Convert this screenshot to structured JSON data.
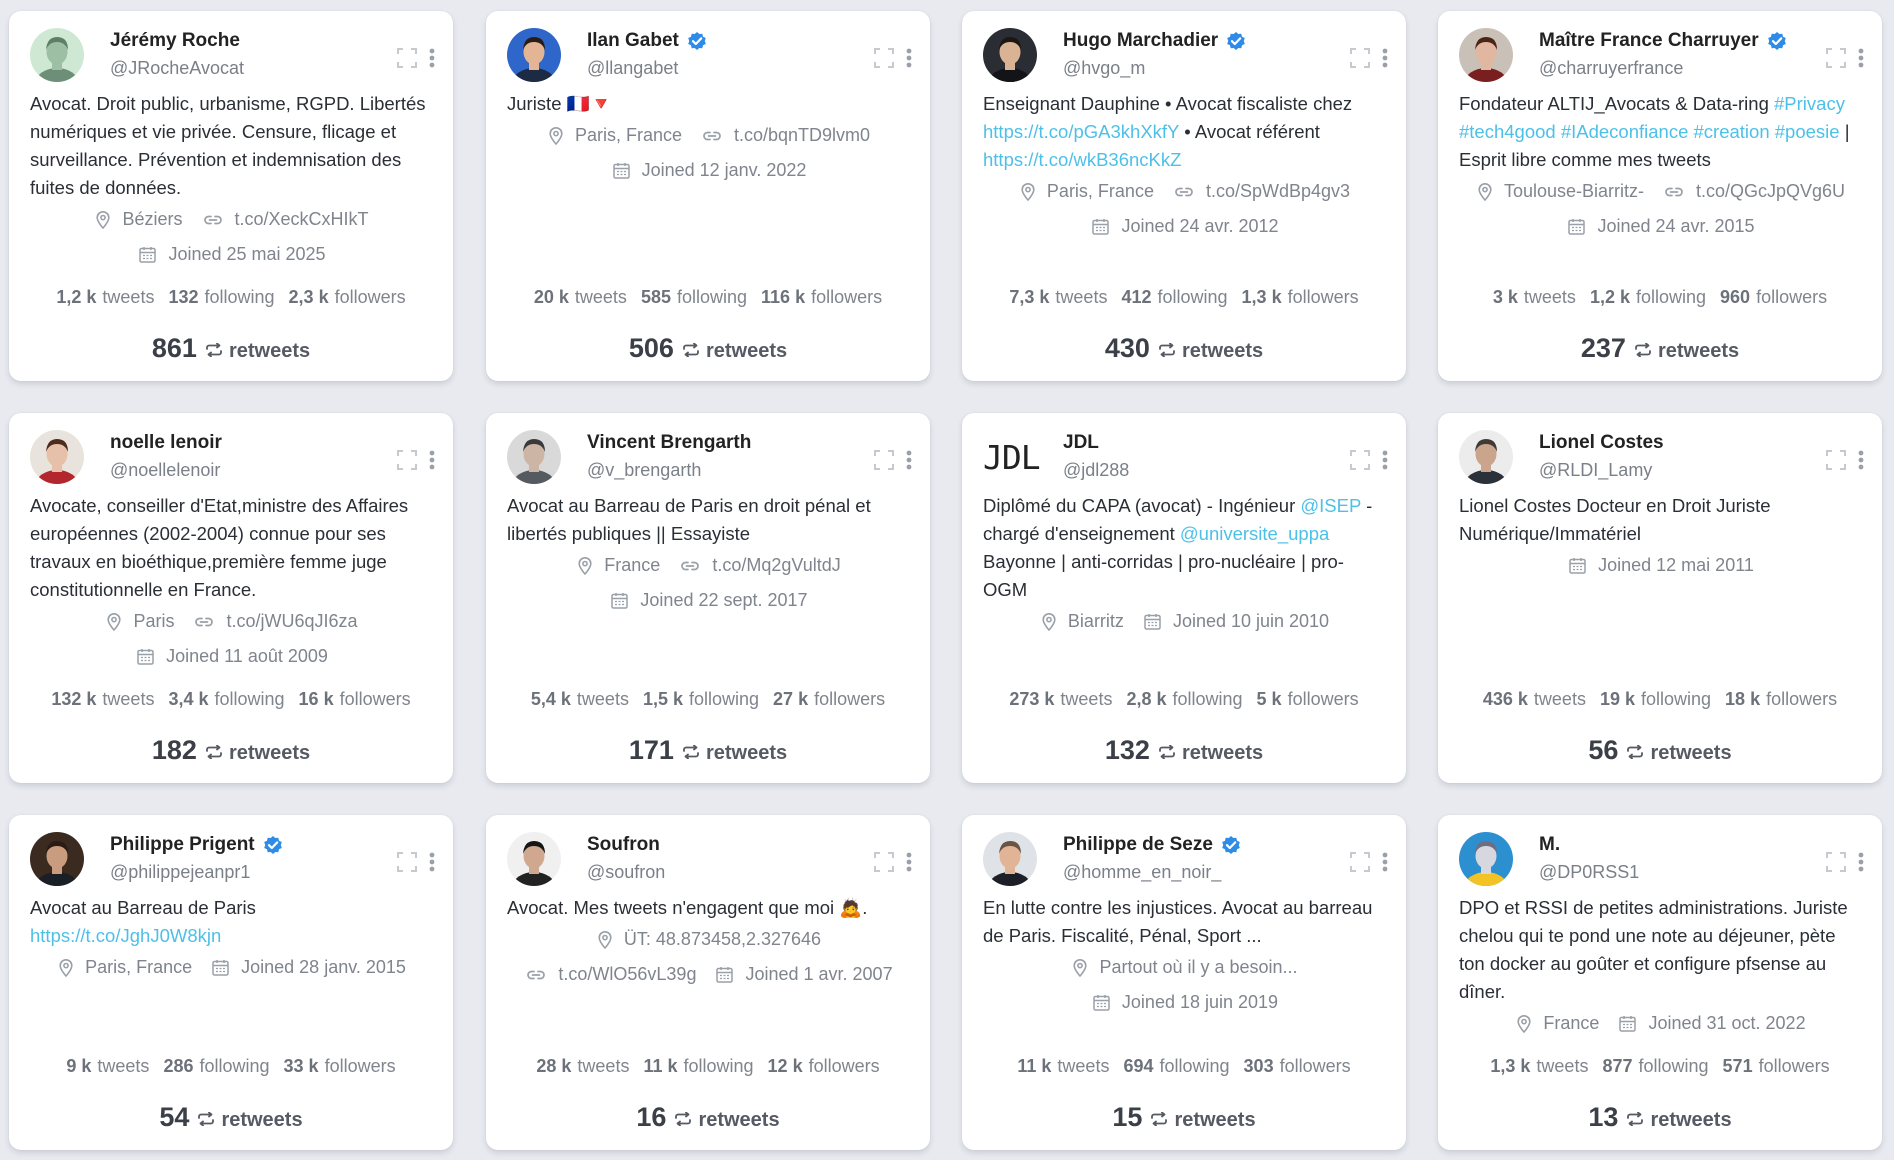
{
  "colors": {
    "link": "#4dc0e8",
    "verified": "#2e8ce8",
    "background": "#e8eaf0"
  },
  "labels": {
    "tweets": "tweets",
    "following": "following",
    "followers": "followers",
    "retweets": "retweets"
  },
  "cards": [
    {
      "name": "Jérémy Roche",
      "handle": "@JRocheAvocat",
      "verified": false,
      "avatar": "avatar-a",
      "bio": "Avocat. Droit public, urbanisme, RGPD. Libertés numériques et vie privée. Censure, flicage et surveillance. Prévention et indemnisation des fuites de données.",
      "location": "Béziers",
      "url": "t.co/XeckCxHIkT",
      "joined": "Joined 25 mai 2025",
      "tweets": "1,2 k",
      "following": "132",
      "followers": "2,3 k",
      "retweets": "861"
    },
    {
      "name": "Ilan Gabet",
      "handle": "@llangabet",
      "verified": true,
      "avatar": "avatar-b",
      "bio": "Juriste 🇫🇷🔻",
      "location": "Paris, France",
      "url": "t.co/bqnTD9lvm0",
      "joined": "Joined 12 janv. 2022",
      "tweets": "20 k",
      "following": "585",
      "followers": "116 k",
      "retweets": "506"
    },
    {
      "name": "Hugo Marchadier",
      "handle": "@hvgo_m",
      "verified": true,
      "avatar": "avatar-c",
      "bio_parts": [
        {
          "t": "Enseignant Dauphine • Avocat fiscaliste chez "
        },
        {
          "t": "https://t.co/pGA3khXkfY",
          "link": true
        },
        {
          "t": " • Avocat référent "
        },
        {
          "t": "https://t.co/wkB36ncKkZ",
          "link": true
        }
      ],
      "location": "Paris, France",
      "url": "t.co/SpWdBp4gv3",
      "joined": "Joined 24 avr. 2012",
      "tweets": "7,3 k",
      "following": "412",
      "followers": "1,3 k",
      "retweets": "430"
    },
    {
      "name": "Maître France Charruyer",
      "handle": "@charruyerfrance",
      "verified": true,
      "avatar": "avatar-d",
      "bio_parts": [
        {
          "t": "Fondateur ALTIJ_Avocats & Data-ring "
        },
        {
          "t": "#Privacy #tech4good #IAdeconfiance #creation #poesie",
          "link": true
        },
        {
          "t": " | Esprit libre comme mes tweets"
        }
      ],
      "location": "Toulouse-Biarritz-",
      "url": "t.co/QGcJpQVg6U",
      "joined": "Joined 24 avr. 2015",
      "tweets": "3 k",
      "following": "1,2 k",
      "followers": "960",
      "retweets": "237"
    },
    {
      "name": "noelle lenoir",
      "handle": "@noellelenoir",
      "verified": false,
      "avatar": "avatar-e",
      "bio": "Avocate, conseiller d'Etat,ministre des Affaires européennes (2002-2004) connue pour ses travaux en bioéthique,première femme juge constitutionnelle en France.",
      "location": "Paris",
      "url": "t.co/jWU6qJI6za",
      "joined": "Joined 11 août 2009",
      "tweets": "132 k",
      "following": "3,4 k",
      "followers": "16 k",
      "retweets": "182"
    },
    {
      "name": "Vincent Brengarth",
      "handle": "@v_brengarth",
      "verified": false,
      "avatar": "avatar-f",
      "bio": "Avocat au Barreau de Paris en droit pénal et libertés publiques || Essayiste",
      "location": "France",
      "url": "t.co/Mq2gVultdJ",
      "joined": "Joined 22 sept. 2017",
      "tweets": "5,4 k",
      "following": "1,5 k",
      "followers": "27 k",
      "retweets": "171"
    },
    {
      "name": "JDL",
      "handle": "@jdl288",
      "verified": false,
      "avatar": "jdl",
      "logo_text": "JDL",
      "bio_parts": [
        {
          "t": "Diplômé du CAPA (avocat) - Ingénieur "
        },
        {
          "t": "@ISEP",
          "link": true
        },
        {
          "t": " - chargé d'enseignement "
        },
        {
          "t": "@universite_uppa",
          "link": true
        },
        {
          "t": " Bayonne | anti-corridas | pro-nucléaire | pro-OGM"
        }
      ],
      "location": "Biarritz",
      "url": "",
      "joined": "Joined 10 juin 2010",
      "tweets": "273 k",
      "following": "2,8 k",
      "followers": "5 k",
      "retweets": "132"
    },
    {
      "name": "Lionel Costes",
      "handle": "@RLDI_Lamy",
      "verified": false,
      "avatar": "avatar-h",
      "bio": "Lionel Costes Docteur en Droit Juriste Numérique/Immatériel",
      "location": "",
      "url": "",
      "joined": "Joined 12 mai 2011",
      "tweets": "436 k",
      "following": "19 k",
      "followers": "18 k",
      "retweets": "56"
    },
    {
      "name": "Philippe Prigent",
      "handle": "@philippejeanpr1",
      "verified": true,
      "avatar": "avatar-i",
      "bio_parts": [
        {
          "t": "Avocat au Barreau de Paris "
        },
        {
          "t": "https://t.co/JghJ0W8kjn",
          "link": true
        }
      ],
      "location": "Paris, France",
      "url": "",
      "joined": "Joined 28 janv. 2015",
      "tweets": "9 k",
      "following": "286",
      "followers": "33 k",
      "retweets": "54"
    },
    {
      "name": "Soufron",
      "handle": "@soufron",
      "verified": false,
      "avatar": "avatar-j",
      "bio": "Avocat. Mes tweets n'engagent que moi 🙇.",
      "location": "ÜT: 48.873458,2.327646",
      "url": "t.co/WlO56vL39g",
      "joined": "Joined 1 avr. 2007",
      "tweets": "28 k",
      "following": "11 k",
      "followers": "12 k",
      "retweets": "16"
    },
    {
      "name": "Philippe de Seze",
      "handle": "@homme_en_noir_",
      "verified": true,
      "avatar": "avatar-k",
      "bio": "En lutte contre les injustices. Avocat au barreau de Paris. Fiscalité, Pénal, Sport ...",
      "location": "Partout où il y a besoin...",
      "url": "",
      "joined": "Joined 18 juin 2019",
      "tweets": "11 k",
      "following": "694",
      "followers": "303",
      "retweets": "15"
    },
    {
      "name": "M.",
      "handle": "@DP0RSS1",
      "verified": false,
      "avatar": "avatar-l",
      "bio": "DPO et RSSI de petites administrations. Juriste chelou qui te pond une note au déjeuner, pète ton docker au goûter et configure pfsense au dîner.",
      "location": "France",
      "url": "",
      "joined": "Joined 31 oct. 2022",
      "tweets": "1,3 k",
      "following": "877",
      "followers": "571",
      "retweets": "13"
    }
  ]
}
